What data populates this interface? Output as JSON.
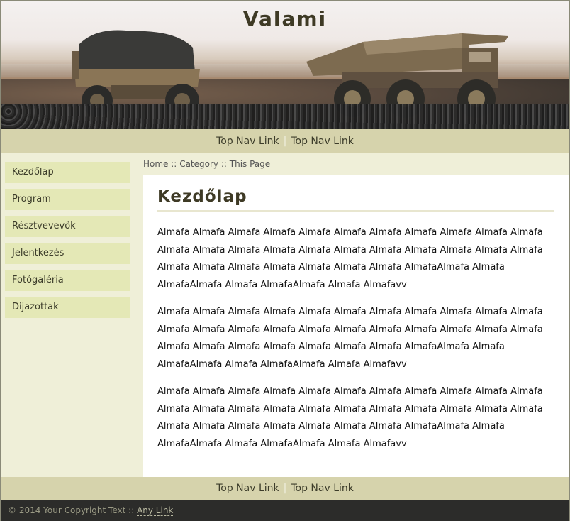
{
  "header": {
    "title": "Valami"
  },
  "topnav": {
    "links": [
      "Top Nav Link",
      "Top Nav Link"
    ],
    "separator": "|"
  },
  "sidebar": {
    "items": [
      {
        "label": "Kezdőlap"
      },
      {
        "label": "Program"
      },
      {
        "label": "Résztvevevők"
      },
      {
        "label": "Jelentkezés"
      },
      {
        "label": "Fotógaléria"
      },
      {
        "label": "Dijazottak"
      }
    ]
  },
  "breadcrumb": {
    "home": "Home",
    "sep1": "::",
    "category": "Category",
    "sep2": "::",
    "current": "This Page"
  },
  "content": {
    "heading": "Kezdőlap",
    "paragraphs": [
      "Almafa Almafa Almafa Almafa Almafa Almafa Almafa Almafa Almafa Almafa Almafa Almafa Almafa Almafa Almafa Almafa Almafa Almafa Almafa Almafa Almafa Almafa Almafa Almafa Almafa Almafa Almafa Almafa Almafa AlmafaAlmafa Almafa AlmafaAlmafa Almafa AlmafaAlmafa Almafa Almafavv",
      "Almafa Almafa Almafa Almafa Almafa Almafa Almafa Almafa Almafa Almafa Almafa Almafa Almafa Almafa Almafa Almafa Almafa Almafa Almafa Almafa Almafa Almafa Almafa Almafa Almafa Almafa Almafa Almafa Almafa AlmafaAlmafa Almafa AlmafaAlmafa Almafa AlmafaAlmafa Almafa Almafavv",
      "Almafa Almafa Almafa Almafa Almafa Almafa Almafa Almafa Almafa Almafa Almafa Almafa Almafa Almafa Almafa Almafa Almafa Almafa Almafa Almafa Almafa Almafa Almafa Almafa Almafa Almafa Almafa Almafa Almafa AlmafaAlmafa Almafa AlmafaAlmafa Almafa AlmafaAlmafa Almafa Almafavv"
    ]
  },
  "bottomnav": {
    "links": [
      "Top Nav Link",
      "Top Nav Link"
    ],
    "separator": "|"
  },
  "footer": {
    "copyright": "© 2014 Your Copyright Text",
    "sep": "::",
    "link": "Any Link"
  },
  "colors": {
    "nav_bg": "#d6d3ac",
    "sidebar_item_bg": "#e4e8b6",
    "page_bg": "#efefd8",
    "footer_bg": "#2c2c2a",
    "title_color": "#3e3a25"
  }
}
